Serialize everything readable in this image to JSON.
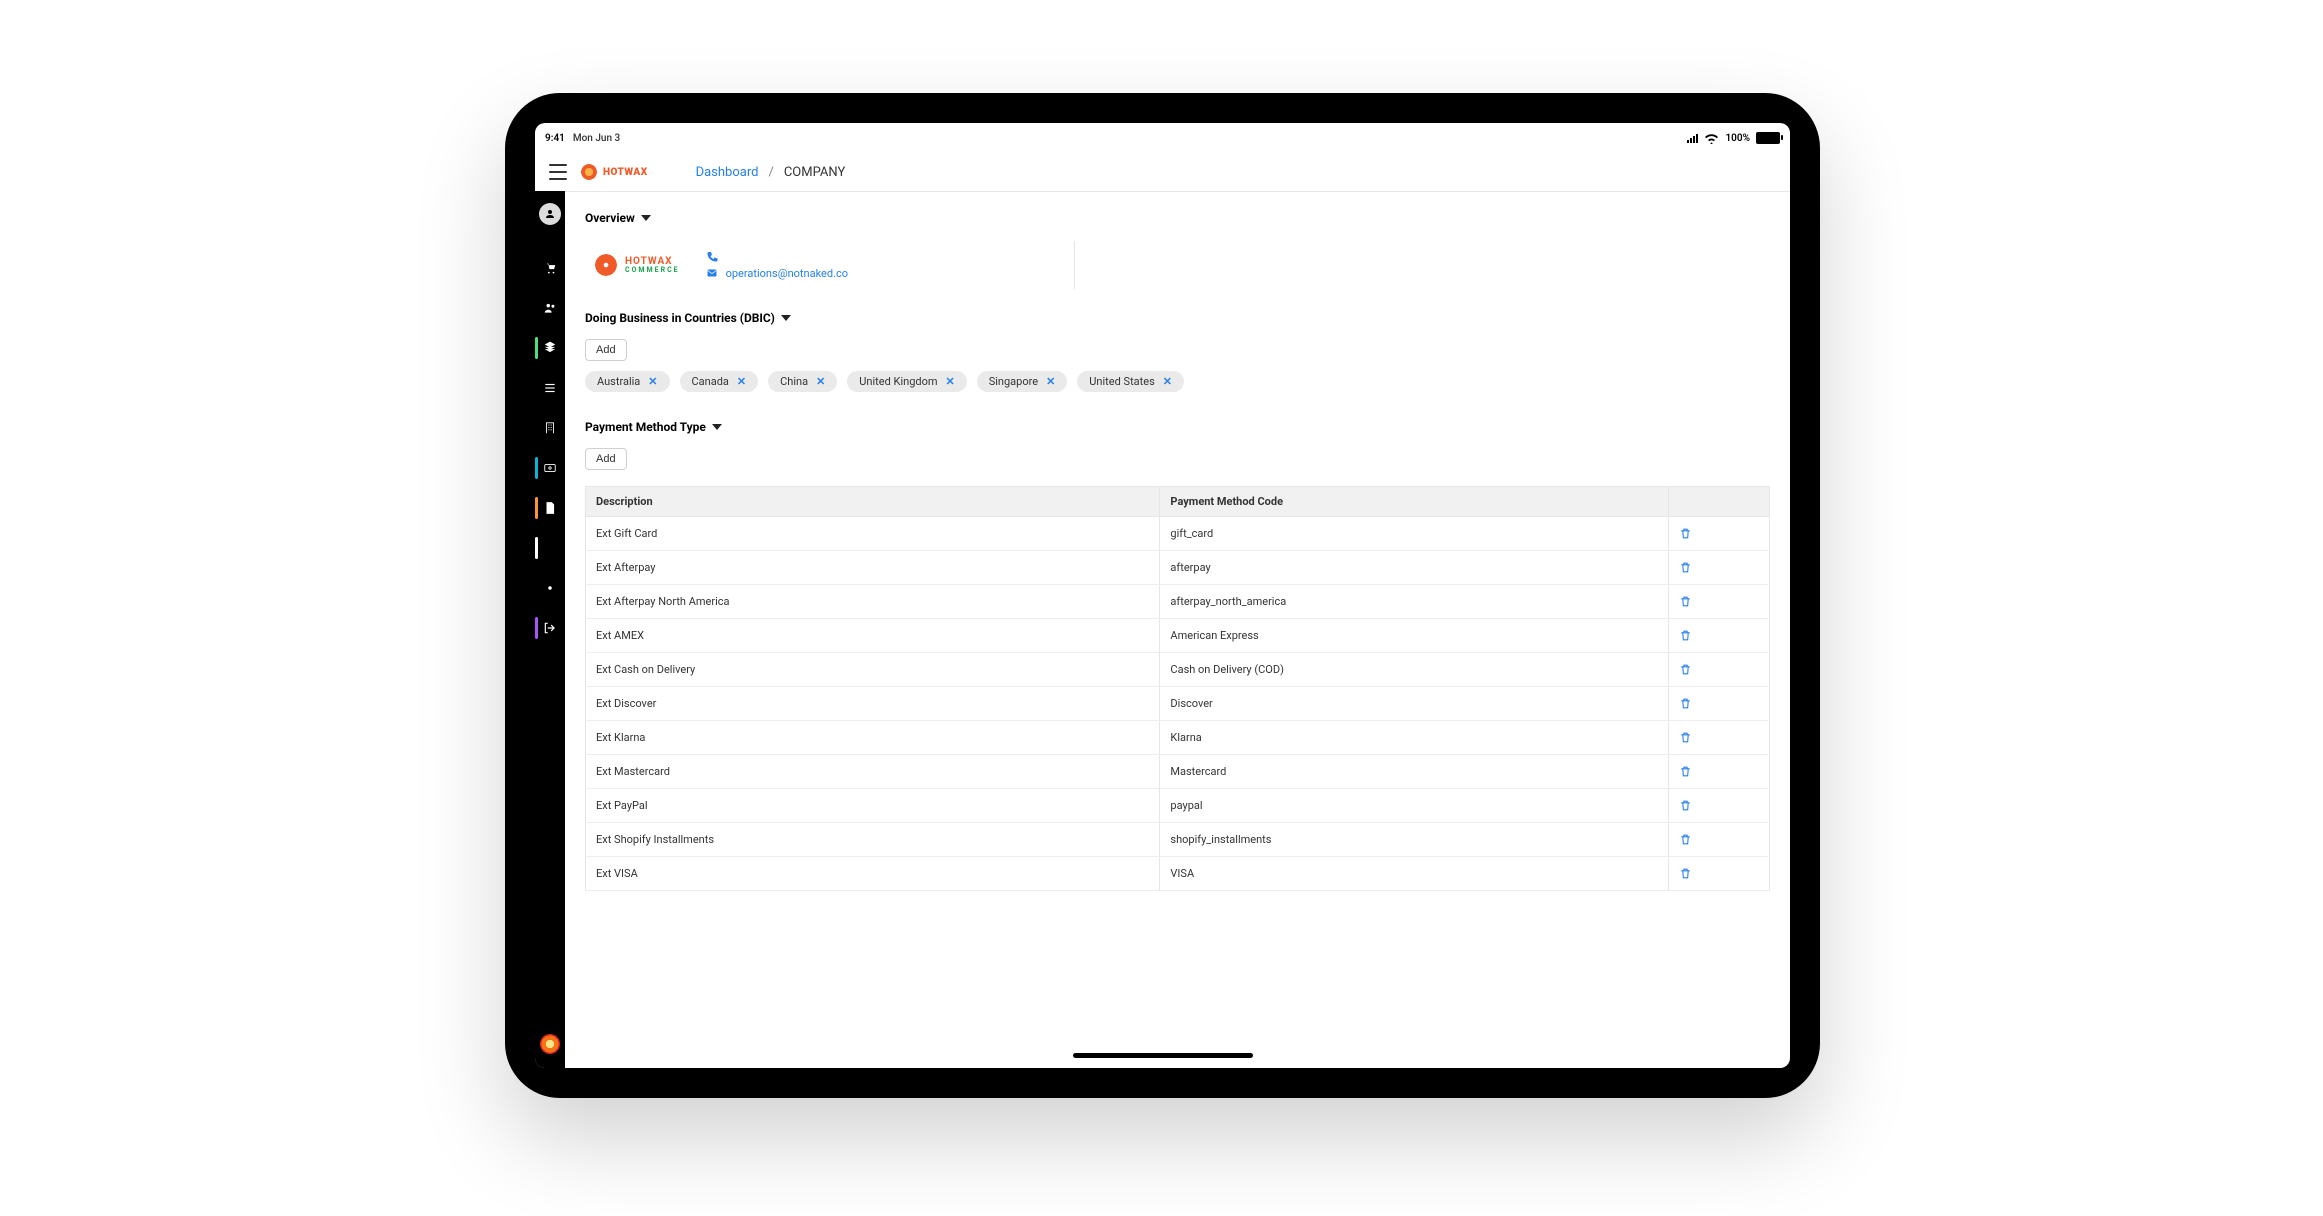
{
  "status": {
    "time": "9:41",
    "date": "Mon Jun 3",
    "battery_text": "100%"
  },
  "brand": {
    "name_html": "HOTWAX"
  },
  "breadcrumb": {
    "root": "Dashboard",
    "sep": "/",
    "current": "COMPANY"
  },
  "sections": {
    "overview": "Overview",
    "dbic": "Doing Business in Countries (DBIC)",
    "payment": "Payment Method Type"
  },
  "company": {
    "logo_top": "HOTWAX",
    "logo_bottom": "COMMERCE",
    "email": "operations@notnaked.co"
  },
  "buttons": {
    "add": "Add"
  },
  "countries": [
    "Australia",
    "Canada",
    "China",
    "United Kingdom",
    "Singapore",
    "United States"
  ],
  "pm_headers": {
    "desc": "Description",
    "code": "Payment Method Code"
  },
  "payment_methods": [
    {
      "desc": "Ext Gift Card",
      "code": "gift_card"
    },
    {
      "desc": "Ext Afterpay",
      "code": "afterpay"
    },
    {
      "desc": "Ext Afterpay North America",
      "code": "afterpay_north_america"
    },
    {
      "desc": "Ext AMEX",
      "code": "American Express"
    },
    {
      "desc": "Ext Cash on Delivery",
      "code": "Cash on Delivery (COD)"
    },
    {
      "desc": "Ext Discover",
      "code": "Discover"
    },
    {
      "desc": "Ext Klarna",
      "code": "Klarna"
    },
    {
      "desc": "Ext Mastercard",
      "code": "Mastercard"
    },
    {
      "desc": "Ext PayPal",
      "code": "paypal"
    },
    {
      "desc": "Ext Shopify Installments",
      "code": "shopify_installments"
    },
    {
      "desc": "Ext VISA",
      "code": "VISA"
    }
  ]
}
